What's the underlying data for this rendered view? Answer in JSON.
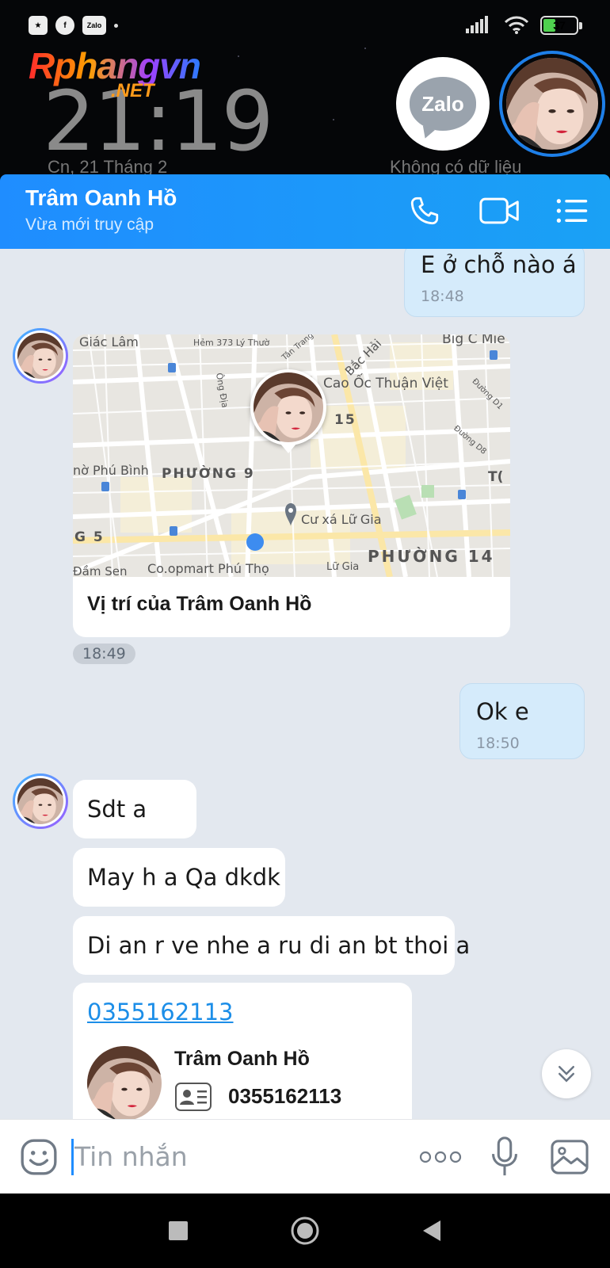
{
  "status_bar": {
    "zalo_badge": "Zalo",
    "battery_level": "37",
    "battery_fraction": 0.37
  },
  "lockscreen": {
    "watermark_main": "Rphangvn",
    "watermark_sub": ".NET",
    "clock": "21:19",
    "date": "Cn, 21 Tháng 2",
    "no_data": "Không có dữ liệu",
    "zalo_label": "Zalo"
  },
  "header": {
    "contact_name": "Trâm Oanh Hồ",
    "contact_status": "Vừa mới truy cập"
  },
  "messages": {
    "m1": {
      "text": "E ở chỗ nào á",
      "time": "18:48"
    },
    "map": {
      "caption": "Vị trí của Trâm Oanh Hồ",
      "time": "18:49",
      "labels": {
        "giac_lam": "Giác Lâm",
        "hem": "Hẻm 373 Lý Thườ",
        "tan_trang": "Tân Trang",
        "bac_hai": "Bắc Hải",
        "big_c": "Big C Miề",
        "ong_dia": "Ông Địa",
        "cao_oc": "Cao Ốc Thuận Việt",
        "duong_d1": "Đường D1",
        "num15": "15",
        "duong_d8": "Đường D8",
        "phu_binh": "nờ Phú Bình",
        "phuong9": "PHƯỜNG 9",
        "t_cut": "T(",
        "cu_xa": "Cư xá Lữ Gia",
        "g5": "G 5",
        "phuong14": "PHƯỜNG 14",
        "dam_sen": "Đầm Sen",
        "coopmart": "Co.opmart Phú Thọ",
        "lu_gia": "Lữ Gia"
      }
    },
    "m2": {
      "text": "Ok e",
      "time": "18:50"
    },
    "m3": {
      "text": "Sdt a"
    },
    "m4": {
      "text": "May h a Qa dkdk"
    },
    "m5": {
      "text": "Di an r ve nhe a ru di an bt thoi a"
    },
    "card": {
      "phone_link": "0355162113",
      "name": "Trâm Oanh Hồ",
      "phone": "0355162113"
    }
  },
  "input": {
    "placeholder": "Tin nhắn"
  },
  "icons": {
    "call": "phone-icon",
    "video": "video-camera-icon",
    "menu": "list-menu-icon",
    "emoji": "emoji-icon",
    "more": "more-dots-icon",
    "mic": "microphone-icon",
    "image": "image-icon",
    "scroll": "chevron-double-down-icon"
  },
  "colors": {
    "header_blue": "#1f8dff",
    "outgoing_bubble": "#d5ebfb",
    "chat_background": "#e3e8ef",
    "link": "#1c8ee8"
  }
}
